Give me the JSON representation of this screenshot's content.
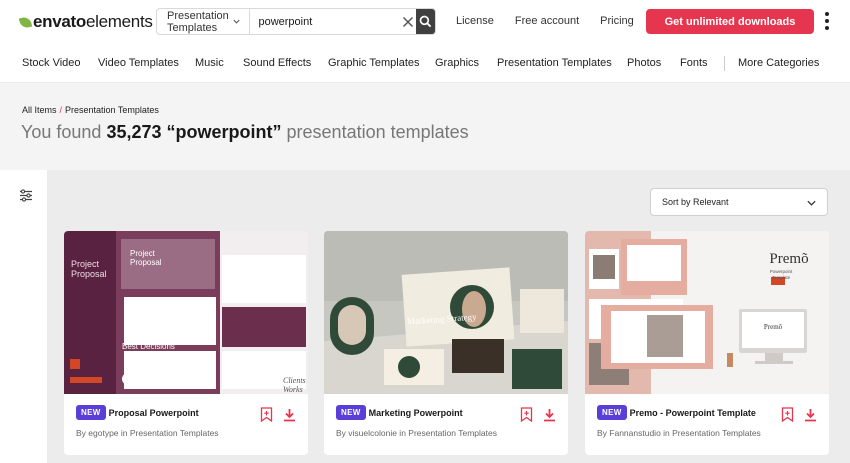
{
  "header": {
    "logo_bold": "envato",
    "logo_light": "elements",
    "search_category": "Presentation Templates",
    "search_value": "powerpoint",
    "nav": [
      "License",
      "Free account",
      "Pricing"
    ],
    "cta": "Get unlimited downloads",
    "accent_color": "#e6354f"
  },
  "categories": [
    "Stock Video",
    "Video Templates",
    "Music",
    "Sound Effects",
    "Graphic Templates",
    "Graphics",
    "Presentation Templates",
    "Photos",
    "Fonts",
    "More Categories"
  ],
  "breadcrumb": {
    "root": "All Items",
    "sep": "/",
    "current": "Presentation Templates"
  },
  "results": {
    "prefix": "You found",
    "count": "35,273",
    "query": "“powerpoint”",
    "suffix": "presentation templates"
  },
  "sort": {
    "label": "Sort by Relevant"
  },
  "cards": [
    {
      "badge": "NEW",
      "title": "Proposal Powerpoint",
      "meta": "By egotype in Presentation Templates",
      "thumb_text": {
        "left_title_1": "Project",
        "left_title_2": "Proposal",
        "center_title_1": "Project",
        "center_title_2": "Proposal",
        "bottom_left": "Best Decisions",
        "bottom_right_1": "Clients",
        "bottom_right_2": "Works"
      }
    },
    {
      "badge": "NEW",
      "title": "Marketing Powerpoint",
      "meta": "By visuelcolonie in Presentation Templates",
      "thumb_text": {
        "main": "Marketing Strategy"
      }
    },
    {
      "badge": "NEW",
      "title": "Premo - Powerpoint Template",
      "meta": "By Fannanstudio in Presentation Templates",
      "thumb_text": {
        "brand": "Premõ",
        "sub_1": "Powerpoint",
        "sub_2": "Template",
        "screen": "Premõ"
      }
    }
  ]
}
